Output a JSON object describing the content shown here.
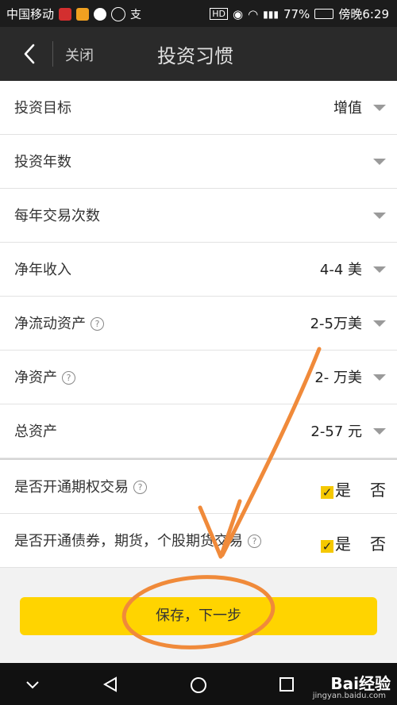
{
  "status_bar": {
    "carrier": "中国移动",
    "battery": "77%",
    "time": "傍晚6:29"
  },
  "navbar": {
    "close_label": "关闭",
    "title": "投资习惯"
  },
  "form": {
    "rows": [
      {
        "label": "投资目标",
        "value": "增值"
      },
      {
        "label": "投资年数",
        "value": ""
      },
      {
        "label": "每年交易次数",
        "value": ""
      },
      {
        "label": "净年收入",
        "value": "4-4 美"
      },
      {
        "label": "净流动资产",
        "value": "2-5万美"
      },
      {
        "label": "净资产",
        "value": "2- 万美"
      },
      {
        "label": "总资产",
        "value": "2-57 元"
      }
    ],
    "options_trading": {
      "label": "是否开通期权交易",
      "yes": "是",
      "no": "否"
    },
    "bonds_futures": {
      "label": "是否开通债券，期货，个股期货交易",
      "yes": "是",
      "no": "否"
    }
  },
  "footer": {
    "save_label": "保存，下一步"
  },
  "watermark": {
    "brand": "Bai经验",
    "sub": "jingyan.baidu.com"
  },
  "colors": {
    "accent_yellow": "#ffd400",
    "annotation_orange": "#f08a3a"
  }
}
